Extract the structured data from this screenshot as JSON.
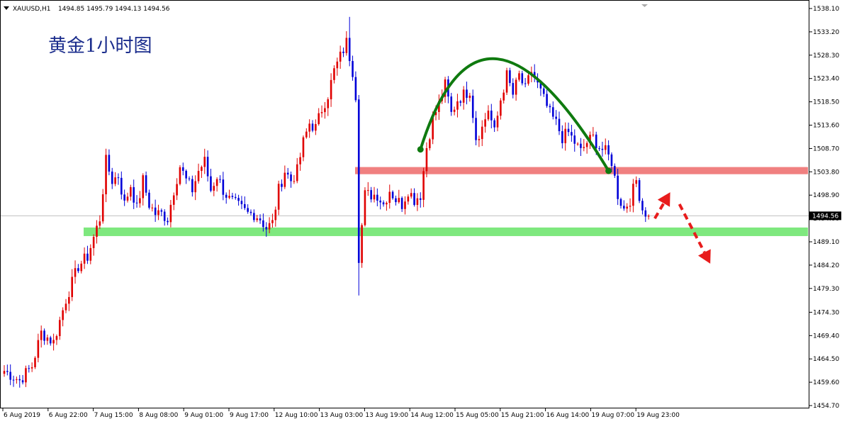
{
  "chart_data": {
    "type": "candlestick",
    "header": {
      "menu_icon": "triangle-down-icon",
      "symbol": "XAUUSD,H1",
      "ohlc": "1494.85 1495.79 1494.13 1494.56"
    },
    "annotation_title": "黄金1小时图",
    "colors": {
      "up": "#e00000",
      "down": "#0000d8",
      "resistance_band": "#f08080",
      "support_band": "#7ee87e",
      "arc": "#0f7a0f",
      "forecast_arrow": "#e81c1c",
      "title_text": "#1a2c8c",
      "price_tag_bg": "#000000"
    },
    "y_axis": {
      "min": 1454.7,
      "max": 1538.1,
      "ticks": [
        "1538.10",
        "1533.20",
        "1528.30",
        "1523.40",
        "1518.50",
        "1513.60",
        "1508.70",
        "1503.80",
        "1498.90",
        "1494.00",
        "1489.10",
        "1484.20",
        "1479.30",
        "1474.30",
        "1469.40",
        "1464.50",
        "1459.60",
        "1454.70"
      ],
      "current_price": 1494.56,
      "current_label": "1494.56"
    },
    "x_axis": {
      "labels": [
        "6 Aug 2019",
        "6 Aug 22:00",
        "7 Aug 15:00",
        "8 Aug 08:00",
        "9 Aug 01:00",
        "9 Aug 17:00",
        "12 Aug 10:00",
        "13 Aug 03:00",
        "13 Aug 19:00",
        "14 Aug 12:00",
        "15 Aug 05:00",
        "15 Aug 21:00",
        "16 Aug 14:00",
        "19 Aug 07:00",
        "19 Aug 23:00"
      ]
    },
    "resistance_zone": {
      "low": 1503.3,
      "high": 1504.8
    },
    "support_zone": {
      "low": 1490.3,
      "high": 1492.1
    },
    "current_price_line": 1494.56,
    "series_path": [
      [
        0,
        1462
      ],
      [
        5,
        1460
      ],
      [
        9,
        1463
      ],
      [
        12,
        1470
      ],
      [
        16,
        1468
      ],
      [
        20,
        1477
      ],
      [
        24,
        1484
      ],
      [
        27,
        1486
      ],
      [
        29,
        1490
      ],
      [
        31,
        1494
      ],
      [
        33,
        1506
      ],
      [
        35,
        1502
      ],
      [
        37,
        1503
      ],
      [
        39,
        1497
      ],
      [
        41,
        1501
      ],
      [
        43,
        1496
      ],
      [
        45,
        1502
      ],
      [
        47,
        1497
      ],
      [
        49,
        1495
      ],
      [
        51,
        1495
      ],
      [
        53,
        1494
      ],
      [
        55,
        1500
      ],
      [
        57,
        1505
      ],
      [
        59,
        1502
      ],
      [
        61,
        1500
      ],
      [
        63,
        1504
      ],
      [
        65,
        1506
      ],
      [
        67,
        1500
      ],
      [
        69,
        1503
      ],
      [
        71,
        1500
      ],
      [
        73,
        1498
      ],
      [
        75,
        1497
      ],
      [
        77,
        1496
      ],
      [
        79,
        1495
      ],
      [
        81,
        1495
      ],
      [
        83,
        1494
      ],
      [
        85,
        1492
      ],
      [
        87,
        1493
      ],
      [
        89,
        1500
      ],
      [
        91,
        1504
      ],
      [
        93,
        1502
      ],
      [
        95,
        1504
      ],
      [
        97,
        1510
      ],
      [
        99,
        1514
      ],
      [
        101,
        1513
      ],
      [
        103,
        1517
      ],
      [
        105,
        1520
      ],
      [
        107,
        1525
      ],
      [
        109,
        1528
      ],
      [
        111,
        1531
      ],
      [
        113,
        1525
      ],
      [
        114,
        1520
      ],
      [
        115,
        1486
      ],
      [
        117,
        1499
      ],
      [
        119,
        1499
      ],
      [
        121,
        1499
      ],
      [
        123,
        1497
      ],
      [
        125,
        1500
      ],
      [
        127,
        1498
      ],
      [
        129,
        1497
      ],
      [
        131,
        1500
      ],
      [
        133,
        1498
      ],
      [
        135,
        1499
      ],
      [
        137,
        1509
      ],
      [
        139,
        1515
      ],
      [
        141,
        1518
      ],
      [
        143,
        1522
      ],
      [
        145,
        1516
      ],
      [
        147,
        1519
      ],
      [
        149,
        1520
      ],
      [
        151,
        1521
      ],
      [
        153,
        1511
      ],
      [
        155,
        1513
      ],
      [
        157,
        1517
      ],
      [
        159,
        1512
      ],
      [
        161,
        1519
      ],
      [
        163,
        1524
      ],
      [
        165,
        1520
      ],
      [
        167,
        1524
      ],
      [
        169,
        1521
      ],
      [
        171,
        1525
      ],
      [
        173,
        1522
      ],
      [
        175,
        1519
      ],
      [
        177,
        1516
      ],
      [
        179,
        1514
      ],
      [
        181,
        1511
      ],
      [
        183,
        1512
      ],
      [
        185,
        1510
      ],
      [
        187,
        1508
      ],
      [
        189,
        1510
      ],
      [
        191,
        1511
      ],
      [
        193,
        1509
      ],
      [
        195,
        1508
      ],
      [
        197,
        1506
      ],
      [
        199,
        1499
      ],
      [
        201,
        1496
      ],
      [
        203,
        1498
      ],
      [
        205,
        1502
      ],
      [
        207,
        1496
      ],
      [
        209,
        1494.56
      ]
    ],
    "arc": {
      "start": [
        135,
        1508.5
      ],
      "peak": [
        160,
        1527.5
      ],
      "end": [
        196,
        1504
      ]
    },
    "forecast_arrows": [
      {
        "from": [
          211,
          1494
        ],
        "to": [
          216,
          1499.5
        ]
      },
      {
        "from": [
          219,
          1497
        ],
        "to": [
          229,
          1484.5
        ]
      }
    ]
  }
}
